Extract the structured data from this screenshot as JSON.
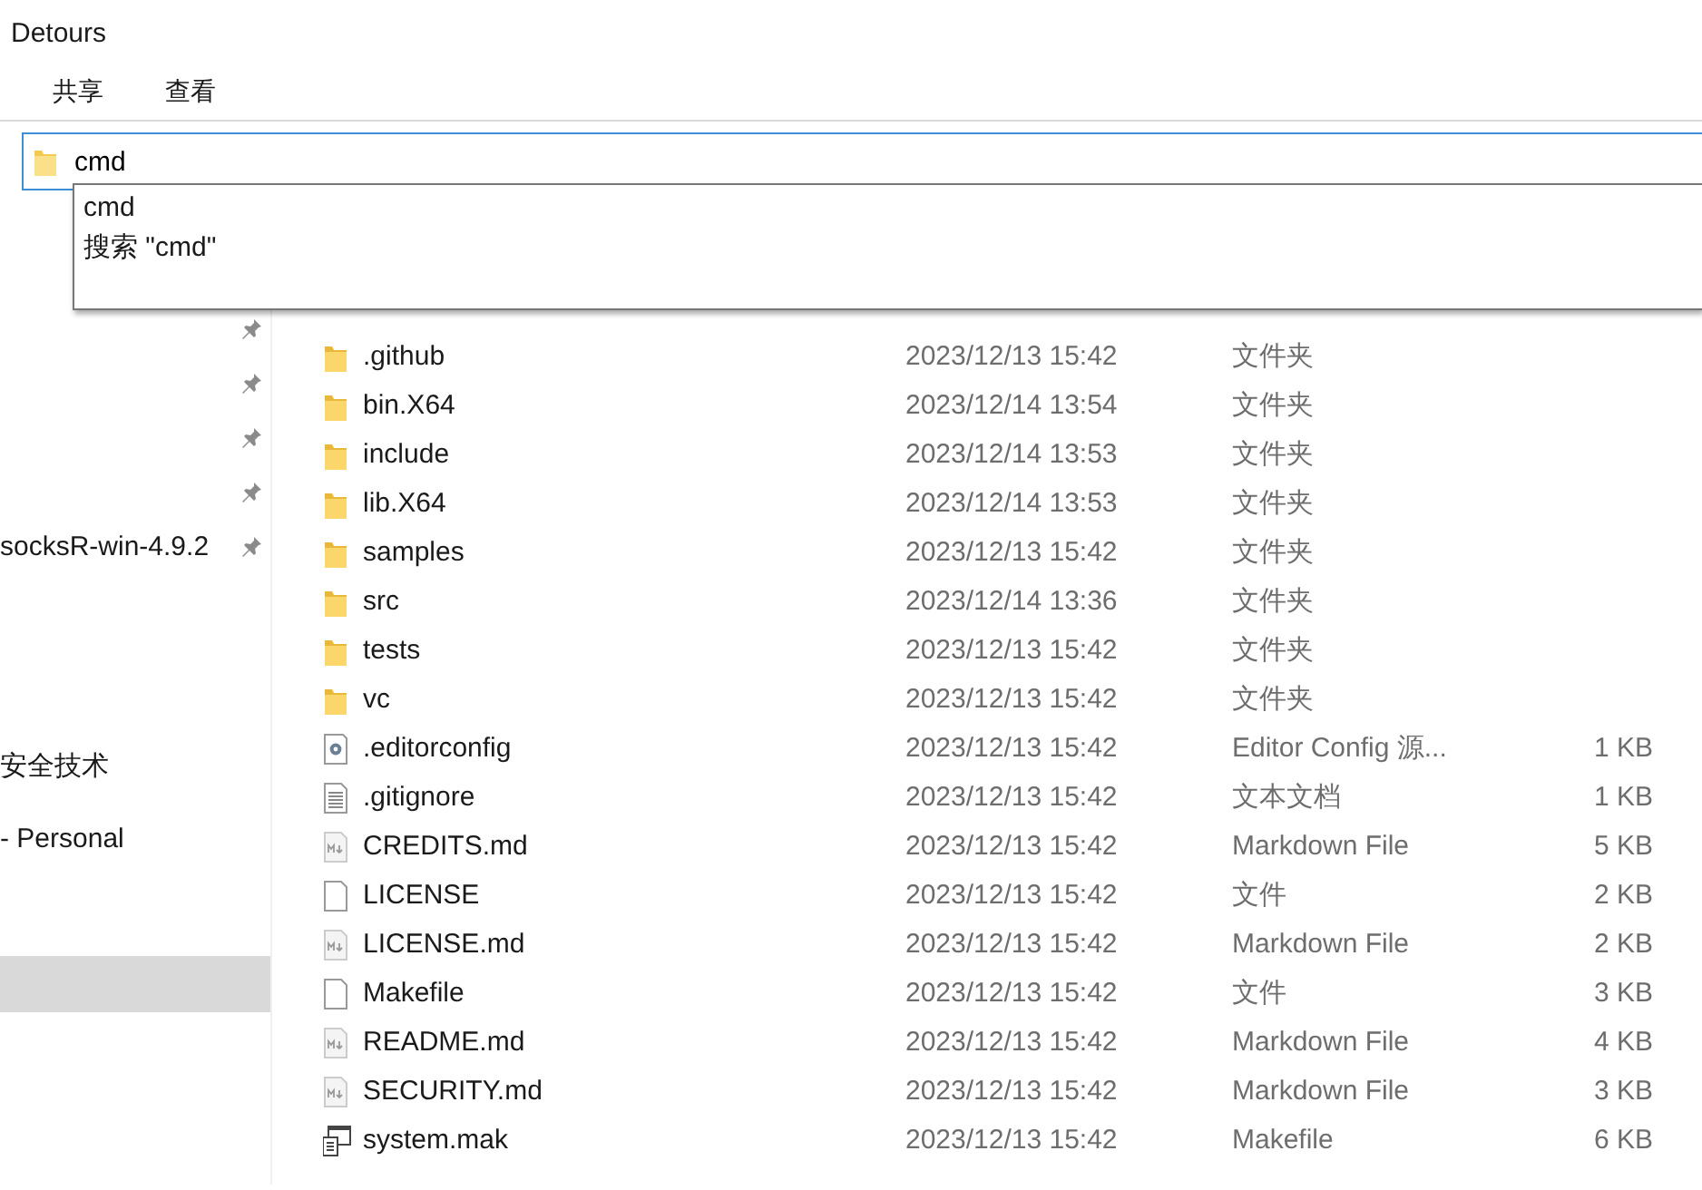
{
  "window": {
    "title": "Detours"
  },
  "ribbon_tabs": [
    {
      "label": "共享"
    },
    {
      "label": "查看"
    }
  ],
  "address_bar": {
    "value": "cmd"
  },
  "suggestions": [
    {
      "label": "cmd"
    },
    {
      "label": "搜索 \"cmd\""
    }
  ],
  "sidebar": {
    "items": [
      {
        "kind": "pinned",
        "selected": false
      },
      {
        "kind": "pinned",
        "selected": false
      },
      {
        "kind": "pinned",
        "selected": false
      },
      {
        "kind": "pinned",
        "selected": false
      },
      {
        "kind": "pinned",
        "label": "socksR-win-4.9.2",
        "selected": false
      },
      {
        "kind": "plain",
        "label": "安全技术",
        "selected": false
      },
      {
        "kind": "plain",
        "label": "- Personal",
        "selected": false
      },
      {
        "kind": "plain",
        "selected": true
      }
    ]
  },
  "files": [
    {
      "kind": "folder",
      "name": ".github",
      "date": "2023/12/13 15:42",
      "type": "文件夹"
    },
    {
      "kind": "folder",
      "name": "bin.X64",
      "date": "2023/12/14 13:54",
      "type": "文件夹"
    },
    {
      "kind": "folder",
      "name": "include",
      "date": "2023/12/14 13:53",
      "type": "文件夹"
    },
    {
      "kind": "folder",
      "name": "lib.X64",
      "date": "2023/12/14 13:53",
      "type": "文件夹"
    },
    {
      "kind": "folder",
      "name": "samples",
      "date": "2023/12/13 15:42",
      "type": "文件夹"
    },
    {
      "kind": "folder",
      "name": "src",
      "date": "2023/12/14 13:36",
      "type": "文件夹"
    },
    {
      "kind": "folder",
      "name": "tests",
      "date": "2023/12/13 15:42",
      "type": "文件夹"
    },
    {
      "kind": "folder",
      "name": "vc",
      "date": "2023/12/13 15:42",
      "type": "文件夹"
    },
    {
      "kind": "config",
      "name": ".editorconfig",
      "date": "2023/12/13 15:42",
      "type": "Editor Config 源...",
      "size": "1 KB"
    },
    {
      "kind": "text",
      "name": ".gitignore",
      "date": "2023/12/13 15:42",
      "type": "文本文档",
      "size": "1 KB"
    },
    {
      "kind": "markdown",
      "name": "CREDITS.md",
      "date": "2023/12/13 15:42",
      "type": "Markdown File",
      "size": "5 KB"
    },
    {
      "kind": "blank",
      "name": "LICENSE",
      "date": "2023/12/13 15:42",
      "type": "文件",
      "size": "2 KB"
    },
    {
      "kind": "markdown",
      "name": "LICENSE.md",
      "date": "2023/12/13 15:42",
      "type": "Markdown File",
      "size": "2 KB"
    },
    {
      "kind": "blank",
      "name": "Makefile",
      "date": "2023/12/13 15:42",
      "type": "文件",
      "size": "3 KB"
    },
    {
      "kind": "markdown",
      "name": "README.md",
      "date": "2023/12/13 15:42",
      "type": "Markdown File",
      "size": "4 KB"
    },
    {
      "kind": "markdown",
      "name": "SECURITY.md",
      "date": "2023/12/13 15:42",
      "type": "Markdown File",
      "size": "3 KB"
    },
    {
      "kind": "makefile",
      "name": "system.mak",
      "date": "2023/12/13 15:42",
      "type": "Makefile",
      "size": "6 KB"
    }
  ]
}
